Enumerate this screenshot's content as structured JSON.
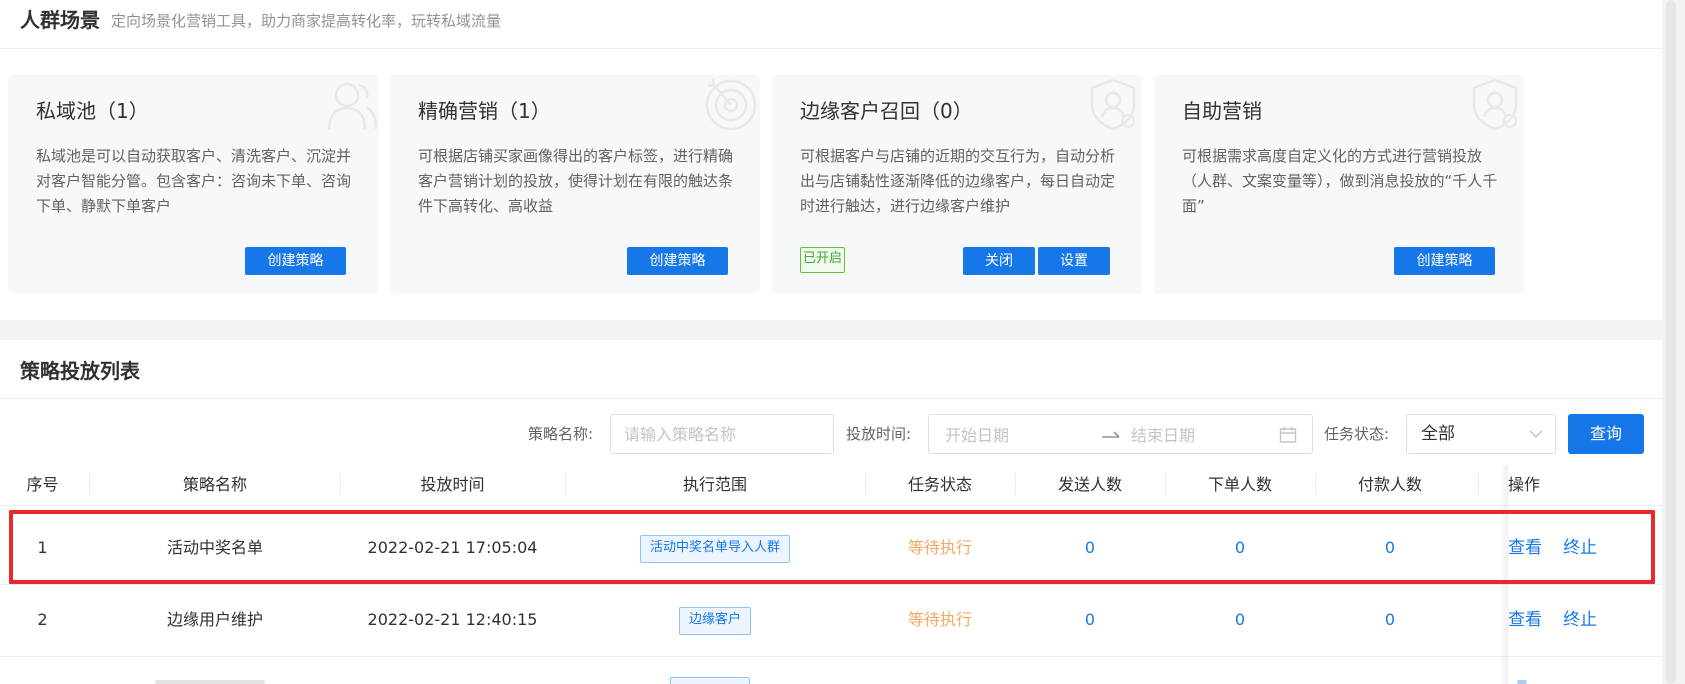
{
  "header": {
    "title": "人群场景",
    "subtitle": "定向场景化营销工具，助力商家提高转化率，玩转私域流量"
  },
  "cards": [
    {
      "title": "私域池（1）",
      "description": "私域池是可以自动获取客户、清洗客户、沉淀并对客户智能分管。包含客户：咨询未下单、咨询下单、静默下单客户",
      "button": "创建策略",
      "icon": "users-icon"
    },
    {
      "title": "精确营销（1）",
      "description": "可根据店铺买家画像得出的客户标签，进行精确客户营销计划的投放，使得计划在有限的触达条件下高转化、高收益",
      "button": "创建策略",
      "icon": "target-icon"
    },
    {
      "title": "边缘客户召回（0）",
      "description": "可根据客户与店铺的近期的交互行为，自动分析出与店铺黏性逐渐降低的边缘客户，每日自动定时进行触达，进行边缘客户维护",
      "status": "已开启",
      "button_close": "关闭",
      "button_settings": "设置",
      "icon": "shield-user-icon"
    },
    {
      "title": "自助营销",
      "description": "可根据需求高度自定义化的方式进行营销投放（人群、文案变量等），做到消息投放的“千人千面”",
      "button": "创建策略",
      "icon": "shield-user-icon"
    }
  ],
  "list": {
    "title": "策略投放列表",
    "filters": {
      "name_label": "策略名称:",
      "name_placeholder": "请输入策略名称",
      "time_label": "投放时间:",
      "start_placeholder": "开始日期",
      "end_placeholder": "结束日期",
      "status_label": "任务状态:",
      "status_value": "全部",
      "query_button": "查询"
    },
    "columns": [
      "序号",
      "策略名称",
      "投放时间",
      "执行范围",
      "任务状态",
      "发送人数",
      "下单人数",
      "付款人数",
      "操作"
    ],
    "rows": [
      {
        "index": "1",
        "name": "活动中奖名单",
        "time": "2022-02-21 17:05:04",
        "scope": "活动中奖名单导入人群",
        "status": "等待执行",
        "sent": "0",
        "ordered": "0",
        "paid": "0",
        "view": "查看",
        "stop": "终止"
      },
      {
        "index": "2",
        "name": "边缘用户维护",
        "time": "2022-02-21 12:40:15",
        "scope": "边缘客户",
        "status": "等待执行",
        "sent": "0",
        "ordered": "0",
        "paid": "0",
        "view": "查看",
        "stop": "终止"
      }
    ]
  },
  "colors": {
    "primary": "#1677e8",
    "waiting": "#f3a95e",
    "enabled": "#3fa83a",
    "highlight": "#e8282b"
  }
}
